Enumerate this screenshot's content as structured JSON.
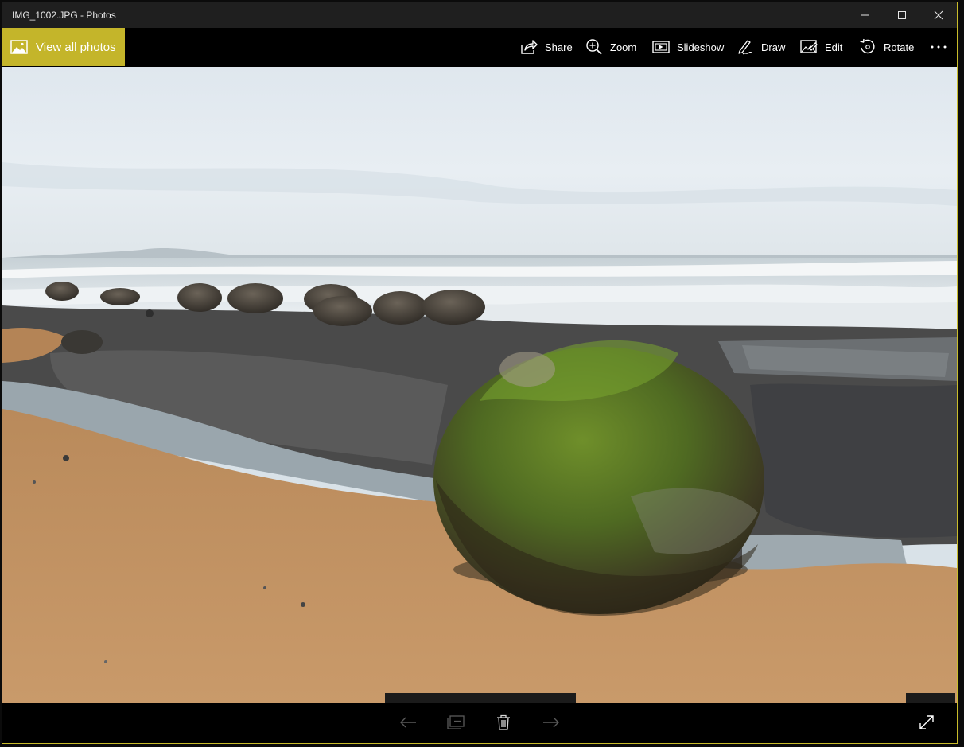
{
  "window": {
    "title": "IMG_1002.JPG - Photos",
    "accent_color": "#c4b52a",
    "controls": [
      "minimize-icon",
      "maximize-icon",
      "close-icon"
    ]
  },
  "toolbar": {
    "view_all_label": "View all photos",
    "view_all_icon": "photo-icon",
    "buttons": [
      {
        "label": "Share",
        "icon": "share-icon"
      },
      {
        "label": "Zoom",
        "icon": "zoom-icon"
      },
      {
        "label": "Slideshow",
        "icon": "slideshow-icon"
      },
      {
        "label": "Draw",
        "icon": "draw-icon"
      },
      {
        "label": "Edit",
        "icon": "edit-icon"
      },
      {
        "label": "Rotate",
        "icon": "rotate-icon"
      }
    ],
    "more_icon": "more-icon"
  },
  "bottom_bar": {
    "buttons": [
      "previous-arrow-icon",
      "add-to-album-icon",
      "delete-icon",
      "next-arrow-icon"
    ],
    "fullscreen_icon": "fullscreen-icon"
  },
  "photo": {
    "subject": "beach-boulders-photo"
  }
}
